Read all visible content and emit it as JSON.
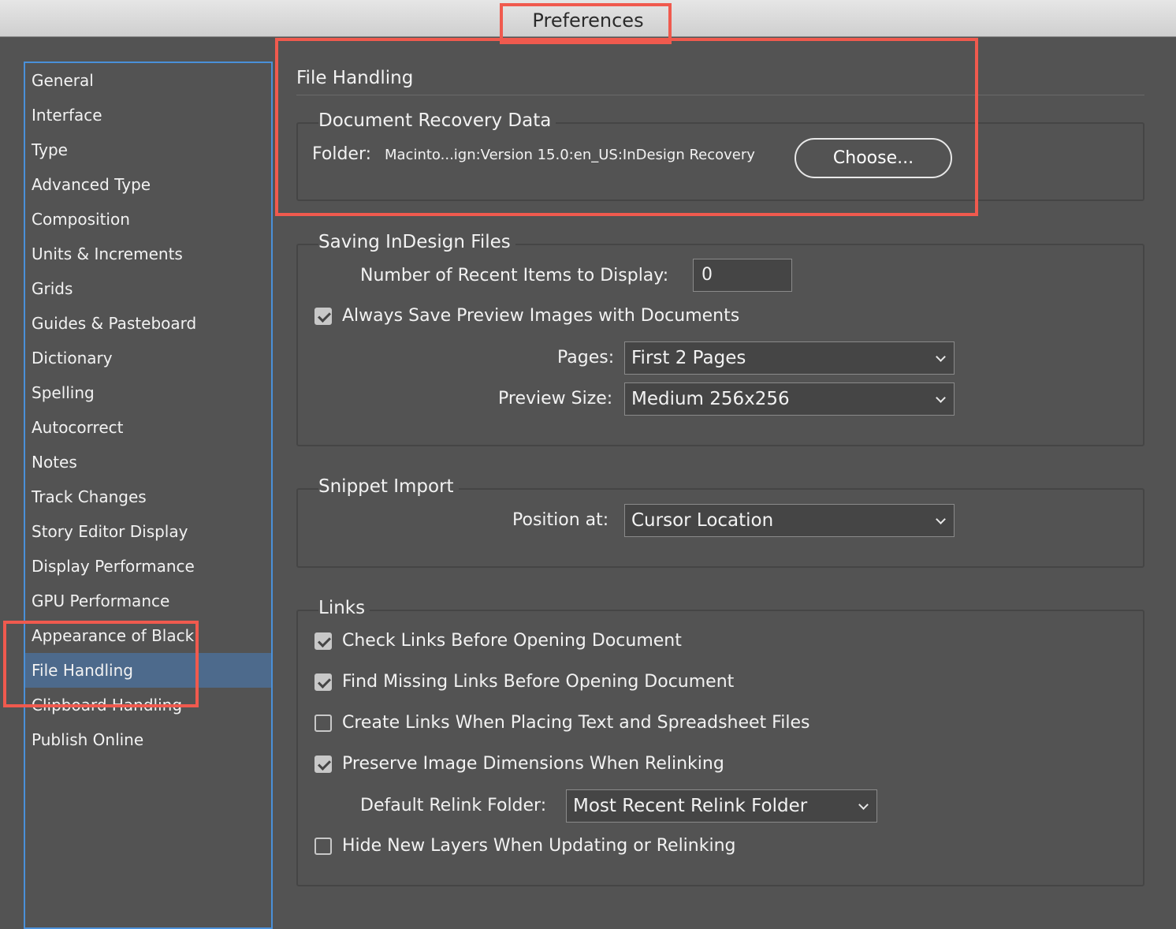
{
  "window": {
    "title": "Preferences"
  },
  "sidebar": {
    "items": [
      {
        "label": "General"
      },
      {
        "label": "Interface"
      },
      {
        "label": "Type"
      },
      {
        "label": "Advanced Type"
      },
      {
        "label": "Composition"
      },
      {
        "label": "Units & Increments"
      },
      {
        "label": "Grids"
      },
      {
        "label": "Guides & Pasteboard"
      },
      {
        "label": "Dictionary"
      },
      {
        "label": "Spelling"
      },
      {
        "label": "Autocorrect"
      },
      {
        "label": "Notes"
      },
      {
        "label": "Track Changes"
      },
      {
        "label": "Story Editor Display"
      },
      {
        "label": "Display Performance"
      },
      {
        "label": "GPU Performance"
      },
      {
        "label": "Appearance of Black"
      },
      {
        "label": "File Handling"
      },
      {
        "label": "Clipboard Handling"
      },
      {
        "label": "Publish Online"
      }
    ],
    "selected": "File Handling"
  },
  "main": {
    "section_title": "File Handling",
    "recovery": {
      "title": "Document Recovery Data",
      "folder_label": "Folder:",
      "folder_path": "Macinto...ign:Version 15.0:en_US:InDesign Recovery",
      "choose_label": "Choose..."
    },
    "saving": {
      "title": "Saving InDesign Files",
      "recent_label": "Number of Recent Items to Display:",
      "recent_value": "0",
      "always_save_label": "Always Save Preview Images with Documents",
      "always_save_checked": true,
      "pages_label": "Pages:",
      "pages_value": "First 2 Pages",
      "preview_size_label": "Preview Size:",
      "preview_size_value": "Medium 256x256"
    },
    "snippet": {
      "title": "Snippet Import",
      "position_label": "Position at:",
      "position_value": "Cursor Location"
    },
    "links": {
      "title": "Links",
      "options": [
        {
          "label": "Check Links Before Opening Document",
          "checked": true
        },
        {
          "label": "Find Missing Links Before Opening Document",
          "checked": true
        },
        {
          "label": "Create Links When Placing Text and Spreadsheet Files",
          "checked": false
        },
        {
          "label": "Preserve Image Dimensions When Relinking",
          "checked": true
        },
        {
          "label": "Hide New Layers When Updating or Relinking",
          "checked": false
        }
      ],
      "relink_label": "Default Relink Folder:",
      "relink_value": "Most Recent Relink Folder"
    }
  },
  "annotation_color": "#f05a4e",
  "accent_color": "#4a90d9"
}
